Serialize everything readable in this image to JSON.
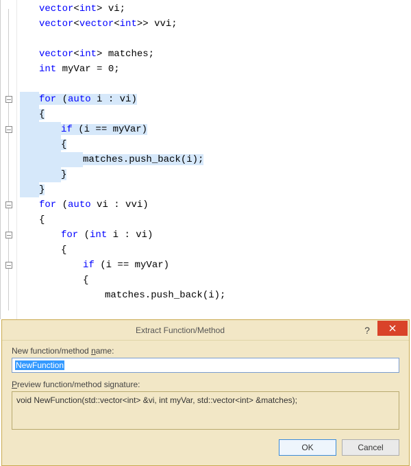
{
  "code": {
    "l1_a": "vector",
    "l1_b": "<",
    "l1_c": "int",
    "l1_d": "> vi;",
    "l2_a": "vector",
    "l2_b": "<",
    "l2_c": "vector",
    "l2_d": "<",
    "l2_e": "int",
    "l2_f": ">> vvi;",
    "l4_a": "vector",
    "l4_b": "<",
    "l4_c": "int",
    "l4_d": "> matches;",
    "l5_a": "int",
    "l5_b": " myVar = 0;",
    "l7_a": "for",
    "l7_b": " (",
    "l7_c": "auto",
    "l7_d": " i : vi)",
    "l8": "{",
    "l9_a": "if",
    "l9_b": " (i == myVar)",
    "l10": "{",
    "l11": "matches.push_back(i);",
    "l12": "}",
    "l13": "}",
    "l14_a": "for",
    "l14_b": " (",
    "l14_c": "auto",
    "l14_d": " vi : vvi)",
    "l15": "{",
    "l16_a": "for",
    "l16_b": " (",
    "l16_c": "int",
    "l16_d": " i : vi)",
    "l17": "{",
    "l18_a": "if",
    "l18_b": " (i == myVar)",
    "l19": "{",
    "l20": "matches.push_back(i);"
  },
  "dialog": {
    "title": "Extract Function/Method",
    "name_label_pre": "New function/method ",
    "name_label_u": "n",
    "name_label_post": "ame:",
    "name_value": "NewFunction",
    "preview_label_u": "P",
    "preview_label_post": "review function/method signature:",
    "preview_text": "void NewFunction(std::vector<int> &vi, int myVar, std::vector<int> &matches);",
    "ok": "OK",
    "cancel": "Cancel",
    "help": "?"
  }
}
